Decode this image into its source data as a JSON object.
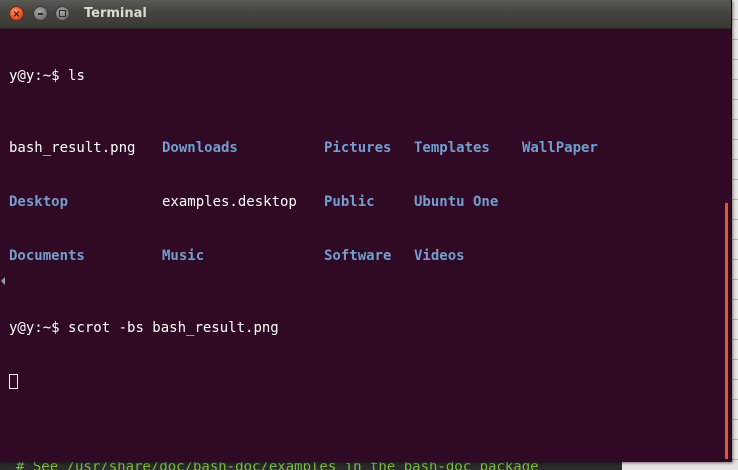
{
  "window": {
    "title": "Terminal"
  },
  "terminal": {
    "prompt1": "y@y:~$ ",
    "cmd1": "ls",
    "ls_rows": [
      [
        {
          "text": "bash_result.png",
          "kind": "file"
        },
        {
          "text": "Downloads",
          "kind": "dir"
        },
        {
          "text": "Pictures",
          "kind": "dir"
        },
        {
          "text": "Templates",
          "kind": "dir"
        },
        {
          "text": "WallPaper",
          "kind": "dir"
        }
      ],
      [
        {
          "text": "Desktop",
          "kind": "dir"
        },
        {
          "text": "examples.desktop",
          "kind": "file"
        },
        {
          "text": "Public",
          "kind": "dir"
        },
        {
          "text": "Ubuntu One",
          "kind": "dir"
        }
      ],
      [
        {
          "text": "Documents",
          "kind": "dir"
        },
        {
          "text": "Music",
          "kind": "dir"
        },
        {
          "text": "Software",
          "kind": "dir"
        },
        {
          "text": "Videos",
          "kind": "dir"
        }
      ]
    ],
    "prompt2": "y@y:~$ ",
    "cmd2": "scrot -bs bash_result.png"
  },
  "background_window": {
    "partial_text": "# See /usr/share/doc/bash-doc/examples in the bash-doc package"
  },
  "colors": {
    "terminal_bg": "#300a24",
    "directory": "#729fcf",
    "text": "#ffffff",
    "scrollbar_accent": "#e15a2a",
    "close_button": "#e8572c"
  },
  "icons": {
    "close": "close-icon",
    "minimize": "minimize-icon",
    "maximize": "maximize-icon"
  }
}
